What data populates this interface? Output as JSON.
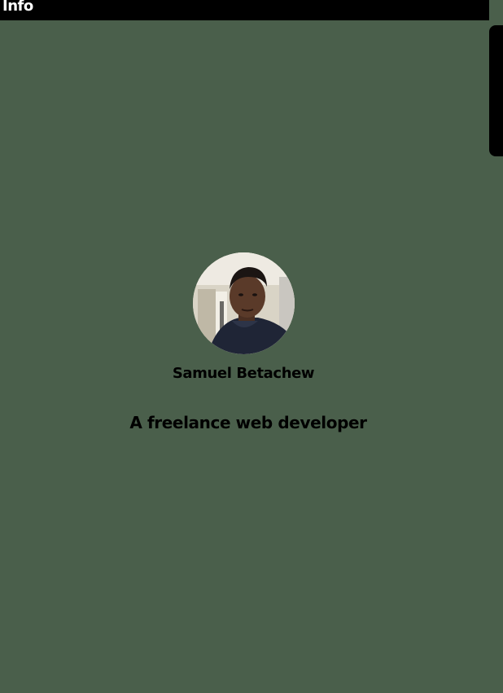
{
  "header": {
    "title": "Info"
  },
  "profile": {
    "avatar_alt": "profile-photo",
    "name": "Samuel Betachew",
    "tagline": "A freelance web developer"
  },
  "colors": {
    "background": "#4a5f4b",
    "header_bg": "#000000",
    "header_text": "#ffffff",
    "text": "#000000"
  }
}
